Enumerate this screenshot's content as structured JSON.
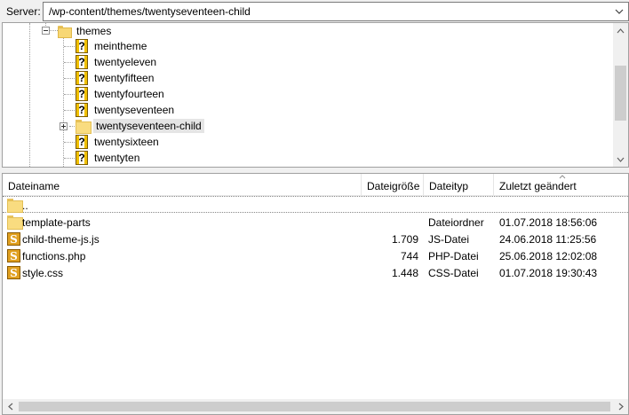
{
  "server_bar": {
    "label": "Server:",
    "path": "/wp-content/themes/twentyseventeen-child"
  },
  "tree": {
    "parent": "themes",
    "items": [
      {
        "label": "meintheme",
        "icon": "question-folder-icon"
      },
      {
        "label": "twentyeleven",
        "icon": "question-folder-icon"
      },
      {
        "label": "twentyfifteen",
        "icon": "question-folder-icon"
      },
      {
        "label": "twentyfourteen",
        "icon": "question-folder-icon"
      },
      {
        "label": "twentyseventeen",
        "icon": "question-folder-icon"
      },
      {
        "label": "twentyseventeen-child",
        "icon": "folder-icon",
        "selected": true
      },
      {
        "label": "twentysixteen",
        "icon": "question-folder-icon"
      },
      {
        "label": "twentyten",
        "icon": "question-folder-icon"
      }
    ]
  },
  "list": {
    "columns": [
      "Dateiname",
      "Dateigröße",
      "Dateityp",
      "Zuletzt geändert"
    ],
    "parent_dir": "..",
    "rows": [
      {
        "name": "template-parts",
        "size": "",
        "type": "Dateiordner",
        "modified": "01.07.2018 18:56:06",
        "icon": "folder-icon"
      },
      {
        "name": "child-theme-js.js",
        "size": "1.709",
        "type": "JS-Datei",
        "modified": "24.06.2018 11:25:56",
        "icon": "sublime-file-icon"
      },
      {
        "name": "functions.php",
        "size": "744",
        "type": "PHP-Datei",
        "modified": "25.06.2018 12:02:08",
        "icon": "sublime-file-icon"
      },
      {
        "name": "style.css",
        "size": "1.448",
        "type": "CSS-Datei",
        "modified": "01.07.2018 19:30:43",
        "icon": "sublime-file-icon"
      }
    ]
  },
  "colors": {
    "folder": "#f7d774",
    "selection": "#e5e5e5",
    "border": "#a0a0a0"
  }
}
